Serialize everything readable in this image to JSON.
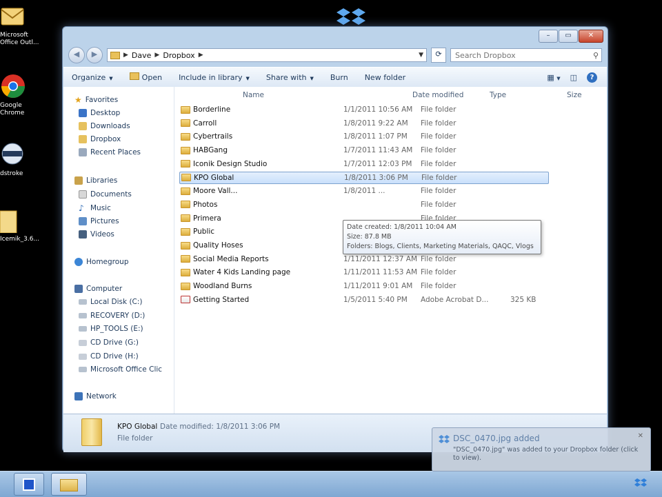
{
  "desktop": {
    "icons": [
      {
        "label": "Microsoft\nOffice Outl..."
      },
      {
        "label": "Google\nChrome"
      },
      {
        "label": "dstroke"
      },
      {
        "label": "Icemik_3.6..."
      }
    ]
  },
  "window": {
    "address": [
      "Dave",
      "Dropbox"
    ],
    "search_placeholder": "Search Dropbox",
    "caption": {
      "min": "–",
      "max": "▭",
      "close": "✕"
    }
  },
  "toolbar": {
    "organize": "Organize",
    "open": "Open",
    "include": "Include in library",
    "share": "Share with",
    "burn": "Burn",
    "new_folder": "New folder"
  },
  "nav": {
    "favorites": "Favorites",
    "desktop": "Desktop",
    "downloads": "Downloads",
    "dropbox": "Dropbox",
    "recent": "Recent Places",
    "libraries": "Libraries",
    "documents": "Documents",
    "music": "Music",
    "pictures": "Pictures",
    "videos": "Videos",
    "homegroup": "Homegroup",
    "computer": "Computer",
    "local_disk": "Local Disk (C:)",
    "recovery": "RECOVERY (D:)",
    "hp_tools": "HP_TOOLS (E:)",
    "cd_g": "CD Drive (G:)",
    "cd_h": "CD Drive (H:)",
    "office": "Microsoft Office Clic",
    "network": "Network"
  },
  "columns": {
    "name": "Name",
    "date": "Date modified",
    "type": "Type",
    "size": "Size"
  },
  "files": [
    {
      "name": "Borderline",
      "date": "1/1/2011 10:56 AM",
      "type": "File folder",
      "size": ""
    },
    {
      "name": "Carroll",
      "date": "1/8/2011 9:22 AM",
      "type": "File folder",
      "size": ""
    },
    {
      "name": "Cybertrails",
      "date": "1/8/2011 1:07 PM",
      "type": "File folder",
      "size": ""
    },
    {
      "name": "HABGang",
      "date": "1/7/2011 11:43 AM",
      "type": "File folder",
      "size": ""
    },
    {
      "name": "Iconik Design Studio",
      "date": "1/7/2011 12:03 PM",
      "type": "File folder",
      "size": ""
    },
    {
      "name": "KPO Global",
      "date": "1/8/2011 3:06 PM",
      "type": "File folder",
      "size": ""
    },
    {
      "name": "Moore Vall...",
      "date": "1/8/2011 ...",
      "type": "File folder",
      "size": ""
    },
    {
      "name": "Photos",
      "date": "",
      "type": "File folder",
      "size": ""
    },
    {
      "name": "Primera",
      "date": "",
      "type": "File folder",
      "size": ""
    },
    {
      "name": "Public",
      "date": "1/1/2011 11:42 AM",
      "type": "File folder",
      "size": ""
    },
    {
      "name": "Quality Hoses",
      "date": "1/11/2011 11:13 AM",
      "type": "File folder",
      "size": ""
    },
    {
      "name": "Social Media Reports",
      "date": "1/11/2011 12:37 AM",
      "type": "File folder",
      "size": ""
    },
    {
      "name": "Water 4 Kids Landing page",
      "date": "1/11/2011 11:53 AM",
      "type": "File folder",
      "size": ""
    },
    {
      "name": "Woodland Burns",
      "date": "1/11/2011 9:01 AM",
      "type": "File folder",
      "size": ""
    },
    {
      "name": "Getting Started",
      "date": "1/5/2011 5:40 PM",
      "type": "Adobe Acrobat D...",
      "size": "325 KB"
    }
  ],
  "tooltip": {
    "line1": "Date created: 1/8/2011 10:04 AM",
    "line2": "Size: 87.8 MB",
    "line3": "Folders: Blogs, Clients, Marketing Materials, QAQC, Vlogs"
  },
  "details": {
    "name": "KPO Global",
    "label": "Date modified: 1/8/2011 3:06 PM",
    "type": "File folder"
  },
  "notification": {
    "title": "DSC_0470.jpg added",
    "message": "\"DSC_0470.jpg\" was added to your Dropbox folder (click to view)."
  }
}
